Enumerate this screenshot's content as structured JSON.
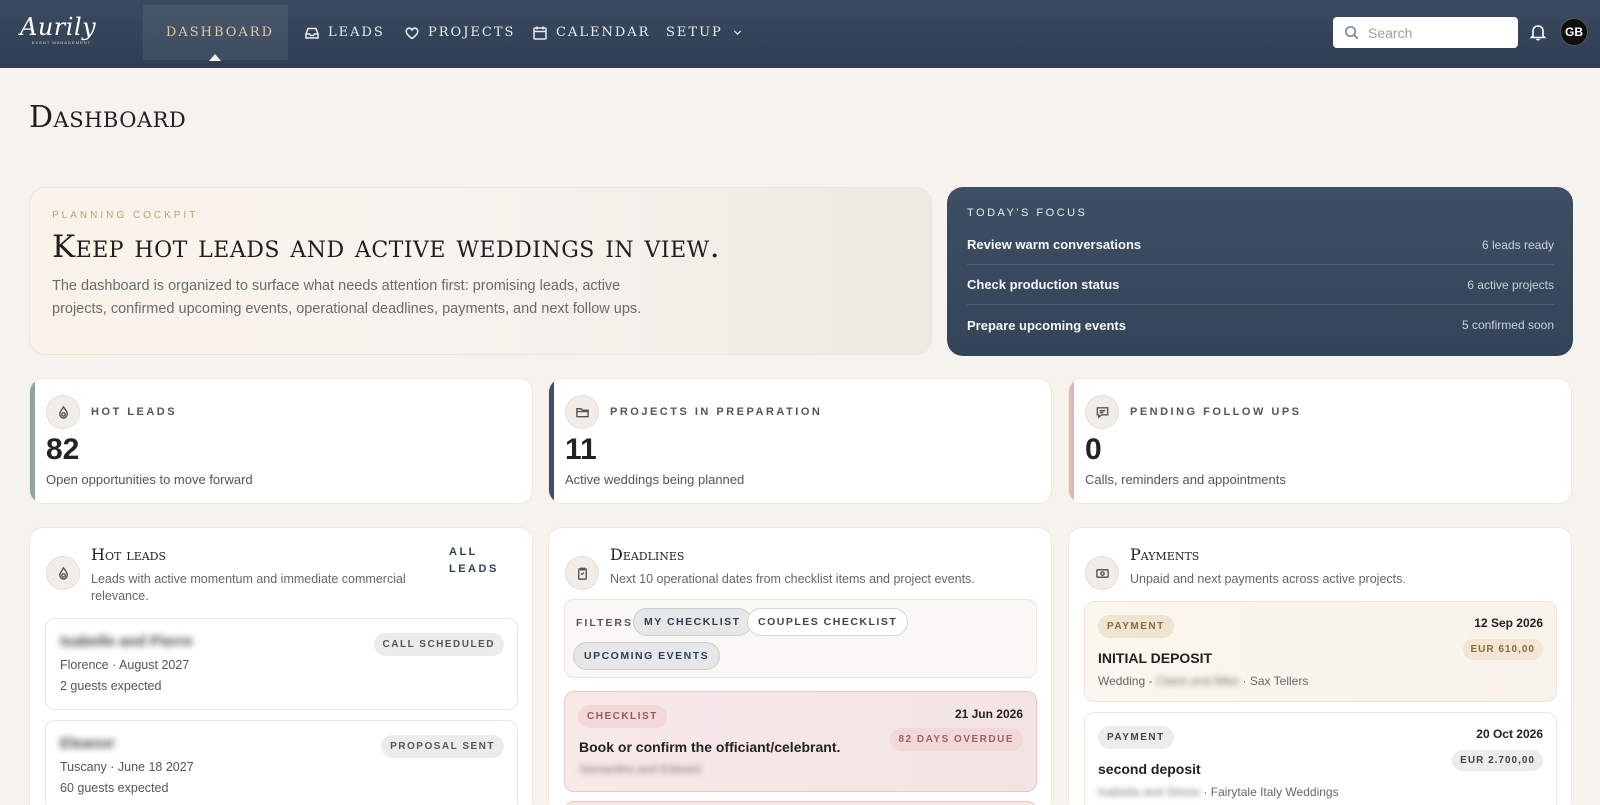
{
  "app": {
    "logo": "Aurily",
    "logo_sub": "EVENT MANAGEMENT"
  },
  "nav": {
    "items": [
      {
        "label": "Dashboard",
        "icon": "home-icon",
        "active": true
      },
      {
        "label": "Leads",
        "icon": "inbox-icon"
      },
      {
        "label": "Projects",
        "icon": "heart-icon"
      },
      {
        "label": "Calendar",
        "icon": "calendar-icon"
      },
      {
        "label": "Setup",
        "icon": "chevron-down-icon"
      }
    ],
    "search_placeholder": "Search",
    "avatar": "GB"
  },
  "page": {
    "title": "Dashboard"
  },
  "hero": {
    "kicker": "Planning Cockpit",
    "title": "Keep hot leads and active weddings in view.",
    "text": "The dashboard is organized to surface what needs attention first: promising leads, active projects, confirmed upcoming events, operational deadlines, payments, and next follow ups."
  },
  "focus": {
    "kicker": "Today's Focus",
    "rows": [
      {
        "label": "Review warm conversations",
        "value": "6 leads ready"
      },
      {
        "label": "Check production status",
        "value": "6 active projects"
      },
      {
        "label": "Prepare upcoming events",
        "value": "5 confirmed soon"
      }
    ]
  },
  "stats": [
    {
      "kicker": "Hot Leads",
      "number": "82",
      "desc": "Open opportunities to move forward",
      "accent": "#8fa59a",
      "icon": "flame-icon"
    },
    {
      "kicker": "Projects in Preparation",
      "number": "11",
      "desc": "Active weddings being planned",
      "accent": "#3f5068",
      "icon": "folder-icon"
    },
    {
      "kicker": "Pending Follow Ups",
      "number": "0",
      "desc": "Calls, reminders and appointments",
      "accent": "#e0b6b6",
      "icon": "chat-icon"
    }
  ],
  "hot_leads": {
    "title": "Hot leads",
    "sub": "Leads with active momentum and immediate commercial relevance.",
    "all_leads": "All Leads",
    "items": [
      {
        "name": "Isabelle and Pierre",
        "meta": "Florence · August 2027",
        "guests": "2 guests expected",
        "status": "Call Scheduled"
      },
      {
        "name": "Eleanor",
        "meta": "Tuscany · June 18 2027",
        "guests": "60 guests expected",
        "status": "Proposal Sent"
      }
    ]
  },
  "deadlines": {
    "title": "Deadlines",
    "sub": "Next 10 operational dates from checklist items and project events.",
    "filters_label": "Filters",
    "filters": [
      "My Checklist",
      "Couples Checklist",
      "Upcoming Events"
    ],
    "items": [
      {
        "tag": "Checklist",
        "date": "21 Jun 2026",
        "overdue": "82 Days Overdue",
        "title": "Book or confirm the officiant/celebrant.",
        "sub": "Samantha and Edward"
      }
    ]
  },
  "payments": {
    "title": "Payments",
    "sub": "Unpaid and next payments across active projects.",
    "items": [
      {
        "tag": "Payment",
        "date": "12 Sep 2026",
        "amount": "EUR 610,00",
        "title": "INITIAL DEPOSIT",
        "meta_prefix": "Wedding - ",
        "meta_blur": "Claire and Mike",
        "meta_suffix": " · Sax Tellers"
      },
      {
        "tag": "Payment",
        "date": "20 Oct 2026",
        "amount": "EUR 2.700,00",
        "title": "second deposit",
        "meta_prefix": "",
        "meta_blur": "Isabella and Simon",
        "meta_suffix": " · Fairytale Italy Weddings"
      }
    ]
  }
}
